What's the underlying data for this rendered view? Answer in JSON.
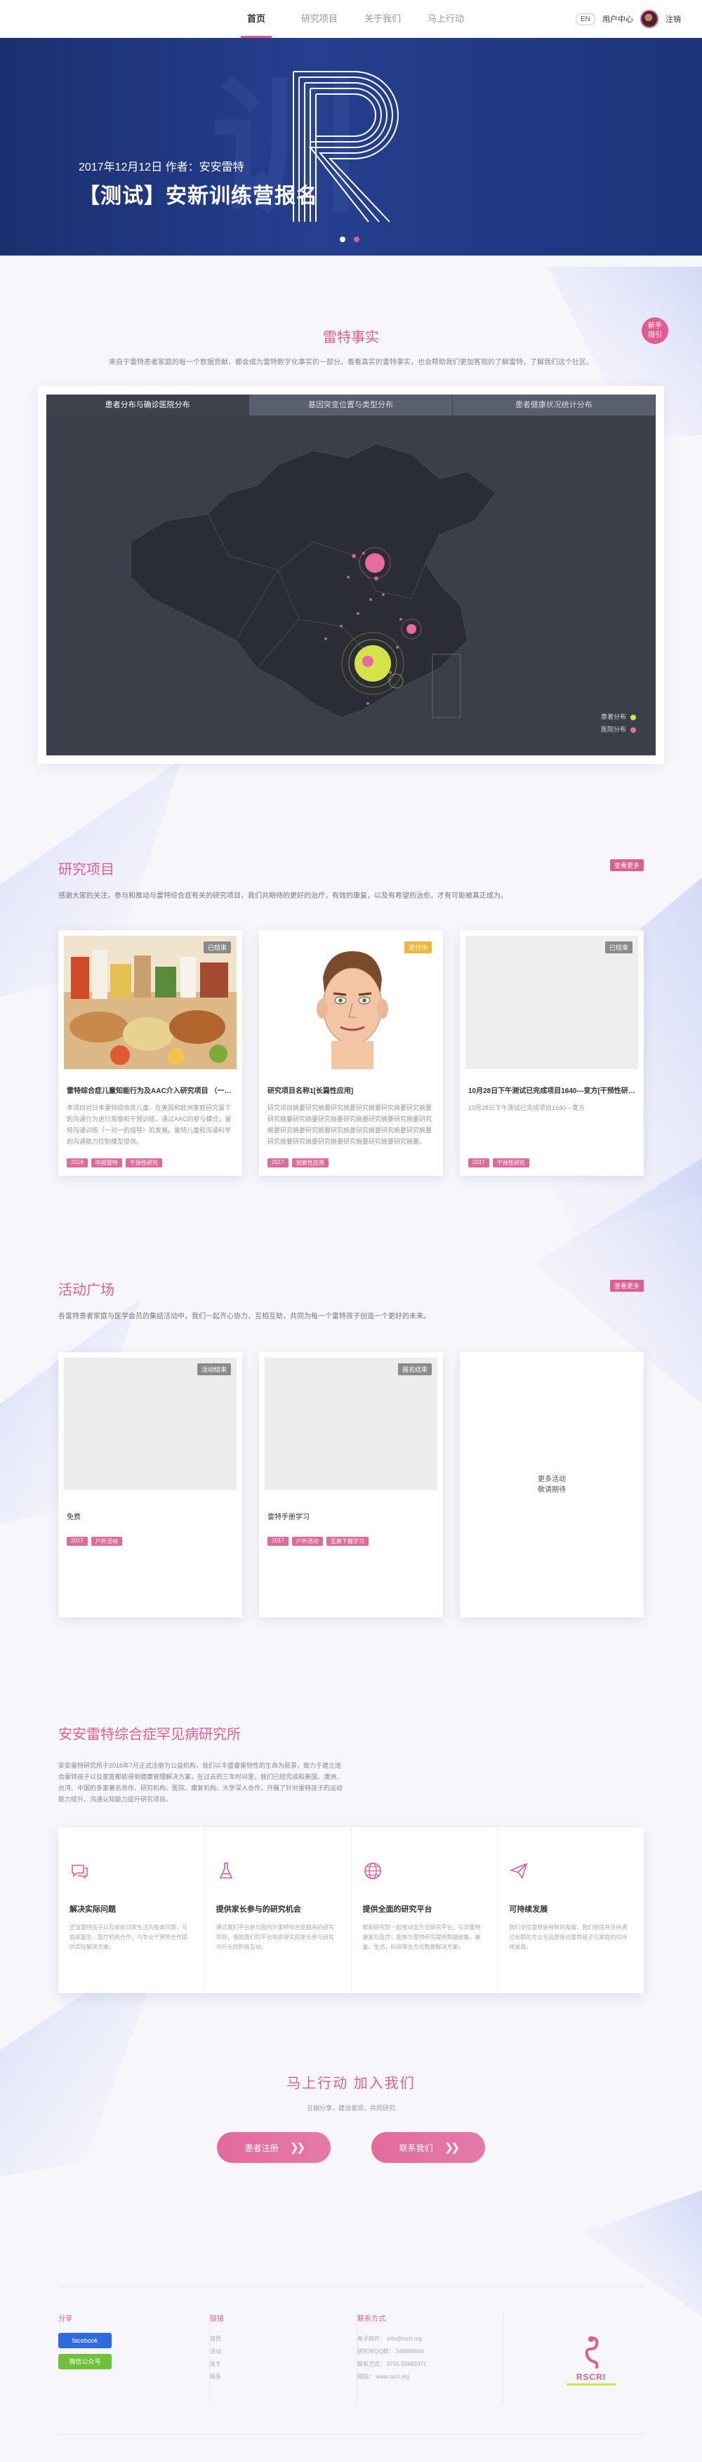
{
  "nav": {
    "items": [
      "首页",
      "研究项目",
      "关于我们",
      "马上行动"
    ],
    "lang": "EN",
    "user_center": "用户中心",
    "logout": "注销"
  },
  "banner": {
    "date_author": "2017年12月12日  作者：安安雷特",
    "title": "【测试】安新训练营报名",
    "letter": "R"
  },
  "facts": {
    "title": "雷特事实",
    "subtitle": "来自于雷特患者家庭的每一个数据贡献，都会成为雷特数字化事实的一部分。看看真实的雷特事实，也会帮助我们更加客观的了解雷特，了解我们这个社区。",
    "newbie_badge_line1": "新手",
    "newbie_badge_line2": "指引",
    "tabs": [
      "患者分布与确诊医院分布",
      "基因突变位置与类型分布",
      "患者健康状况统计分布"
    ],
    "legend": [
      {
        "label": "患者分布",
        "color": "#d4e34a"
      },
      {
        "label": "医院分布",
        "color": "#e86aa0"
      }
    ]
  },
  "research": {
    "title": "研究项目",
    "more": "查看更多",
    "subtitle": "感谢大家的关注，参与和推动与雷特综合症有关的研究项目，我们共期待的更好的治疗，有效的康复，以及有希望的治愈，才有可能被真正成为。",
    "cards": [
      {
        "status": "已结束",
        "title": "雷特综合症儿童知能行为及AAC介入研究项目 （一期）",
        "desc": "本项目对日本雷特综合症儿童、在美国和欧洲家庭研究量下的沟通行为进行观察和干预训练，通过AAC的参与模式，雷特沟通训练（一对一的指导）的发展。雷特儿童和沟通科学的沟通能力控制模型提供。",
        "tags": [
          "2016",
          "中国雷特",
          "干预性研究"
        ]
      },
      {
        "status": "进行中",
        "title": "研究项目名称1[长篇性应用]",
        "desc": "研究项目摘要研究摘要研究摘要研究摘要研究摘要研究摘要研究摘要研究摘要研究摘要研究摘要研究摘要研究摘要研究摘要研究摘要研究摘要研究摘要研究摘要研究摘要研究摘要研究摘要研究摘要研究摘要研究摘要研究摘要研究摘要。",
        "tags": [
          "2017",
          "观察性应用"
        ]
      },
      {
        "status": "已结束",
        "title": "10月28日下午测试已完成项目1640---变方[干预性研究]",
        "desc": "10月28日下午测试已完成项目1640---变方",
        "tags": [
          "2017",
          "干预性研究"
        ]
      }
    ]
  },
  "activities": {
    "title": "活动广场",
    "more": "查看更多",
    "subtitle": "各雷特患者家庭与医学会员的集结活动中，我们一起齐心协力，互相互助，共同为每一个雷特孩子创造一个更好的未来。",
    "cards": [
      {
        "status": "活动结束",
        "title": "免费",
        "tags": [
          "2017",
          "户外活动"
        ]
      },
      {
        "status": "报名结束",
        "title": "雷特手册学习",
        "tags": [
          "2017",
          "户外活动",
          "互换下载学习"
        ]
      }
    ],
    "more_card_line1": "更多活动",
    "more_card_line2": "敬请期待"
  },
  "institute": {
    "title": "安安雷特综合症罕见病研究所",
    "desc": "安安雷特研究所于2016年7月正式注册为公益机构，我们以丰盛睿雷特性的生命为愿景，致力于建立连合雷特孩子以及家庭都能得到健康管理解决方案，在过去的三年时间里，我们已经完成和美国、澳洲、台湾、中国的多家著名合作、研究机构、医院、康复机构、大学深入合作，开展了针对雷特孩子的运动能力提升、沟通认知能力提升研究项目。",
    "features": [
      {
        "title": "解决实际问题",
        "desc": "应当雷特孩子以及家庭日常生活的各类问题，与临床医生、医疗机构合作，与专业干预师合作提供实际解决方案。"
      },
      {
        "title": "提供家长参与的研究机会",
        "desc": "通过我们平台参与国内外雷特综合症相关的研究项目，借助我们的平台和资源实现家长参与研究与行业的积极互动。"
      },
      {
        "title": "提供全面的研究平台",
        "desc": "帮助研究院一起推动全方位研究平台，引导雷特康复与医疗，能够为雷特研究提供数据收集，康复，生活，科研等全方位数据解决方案。"
      },
      {
        "title": "可持续发展",
        "desc": "我们坚信雷特会有新的发展，我们相信并坚持通过长期的专业化运营推动雷特孩子与家庭的可持续发展。"
      }
    ]
  },
  "cta": {
    "title": "马上行动   加入我们",
    "subtitle": "互相分享，建设发现，共同研究",
    "buttons": [
      "患者注册",
      "联系我们"
    ]
  },
  "footer": {
    "share_head": "分享",
    "facebook": "facebook",
    "wechat": "微信公众号",
    "links_head": "链接",
    "links": [
      "首页",
      "活动",
      "关于",
      "联系"
    ],
    "contact_head": "联系方式",
    "contact": [
      "电子邮件： info@rscri.org",
      "研究所QQ群：  346888604",
      "联系方式：  0755-26663371",
      "网站：   www.rscri.org"
    ],
    "logo_text": "RSCRI"
  }
}
